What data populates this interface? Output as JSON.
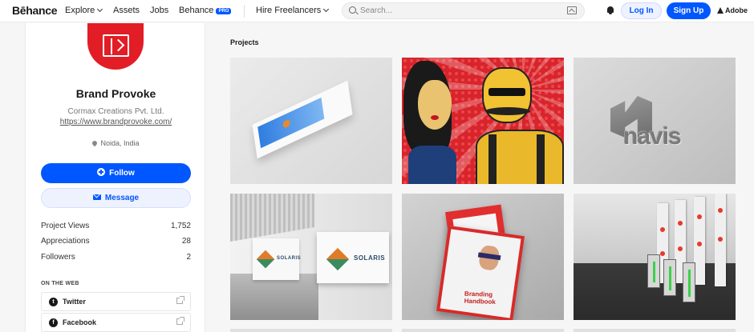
{
  "nav": {
    "logo": "Bēhance",
    "explore": "Explore",
    "assets": "Assets",
    "jobs": "Jobs",
    "behance": "Behance",
    "pro_badge": "PRO",
    "hire": "Hire Freelancers",
    "search_placeholder": "Search...",
    "login": "Log In",
    "signup": "Sign Up",
    "adobe": "Adobe"
  },
  "profile": {
    "name": "Brand Provoke",
    "company": "Cormax Creations Pvt. Ltd.",
    "website": "https://www.brandprovoke.com/",
    "location": "Noida, India",
    "follow": "Follow",
    "message": "Message"
  },
  "stats": [
    {
      "label": "Project Views",
      "value": "1,752"
    },
    {
      "label": "Appreciations",
      "value": "28"
    },
    {
      "label": "Followers",
      "value": "2"
    }
  ],
  "on_the_web": {
    "heading": "ON THE WEB",
    "links": [
      {
        "label": "Twitter",
        "icon": "twitter-icon"
      },
      {
        "label": "Facebook",
        "icon": "facebook-icon"
      }
    ]
  },
  "projects": {
    "heading": "Projects",
    "cards": [
      {
        "art": "brochure-mockup"
      },
      {
        "art": "pop-art-illustration"
      },
      {
        "art": "navis-logo-emboss",
        "logo_text": "navis"
      },
      {
        "art": "solaris-signage",
        "sign_text": "SOLARIS"
      },
      {
        "art": "branding-handbook",
        "cover_text": "Branding Handbook"
      },
      {
        "art": "turnstile-render"
      }
    ]
  },
  "colors": {
    "brand_blue": "#0057ff",
    "avatar_red": "#e21d25"
  }
}
